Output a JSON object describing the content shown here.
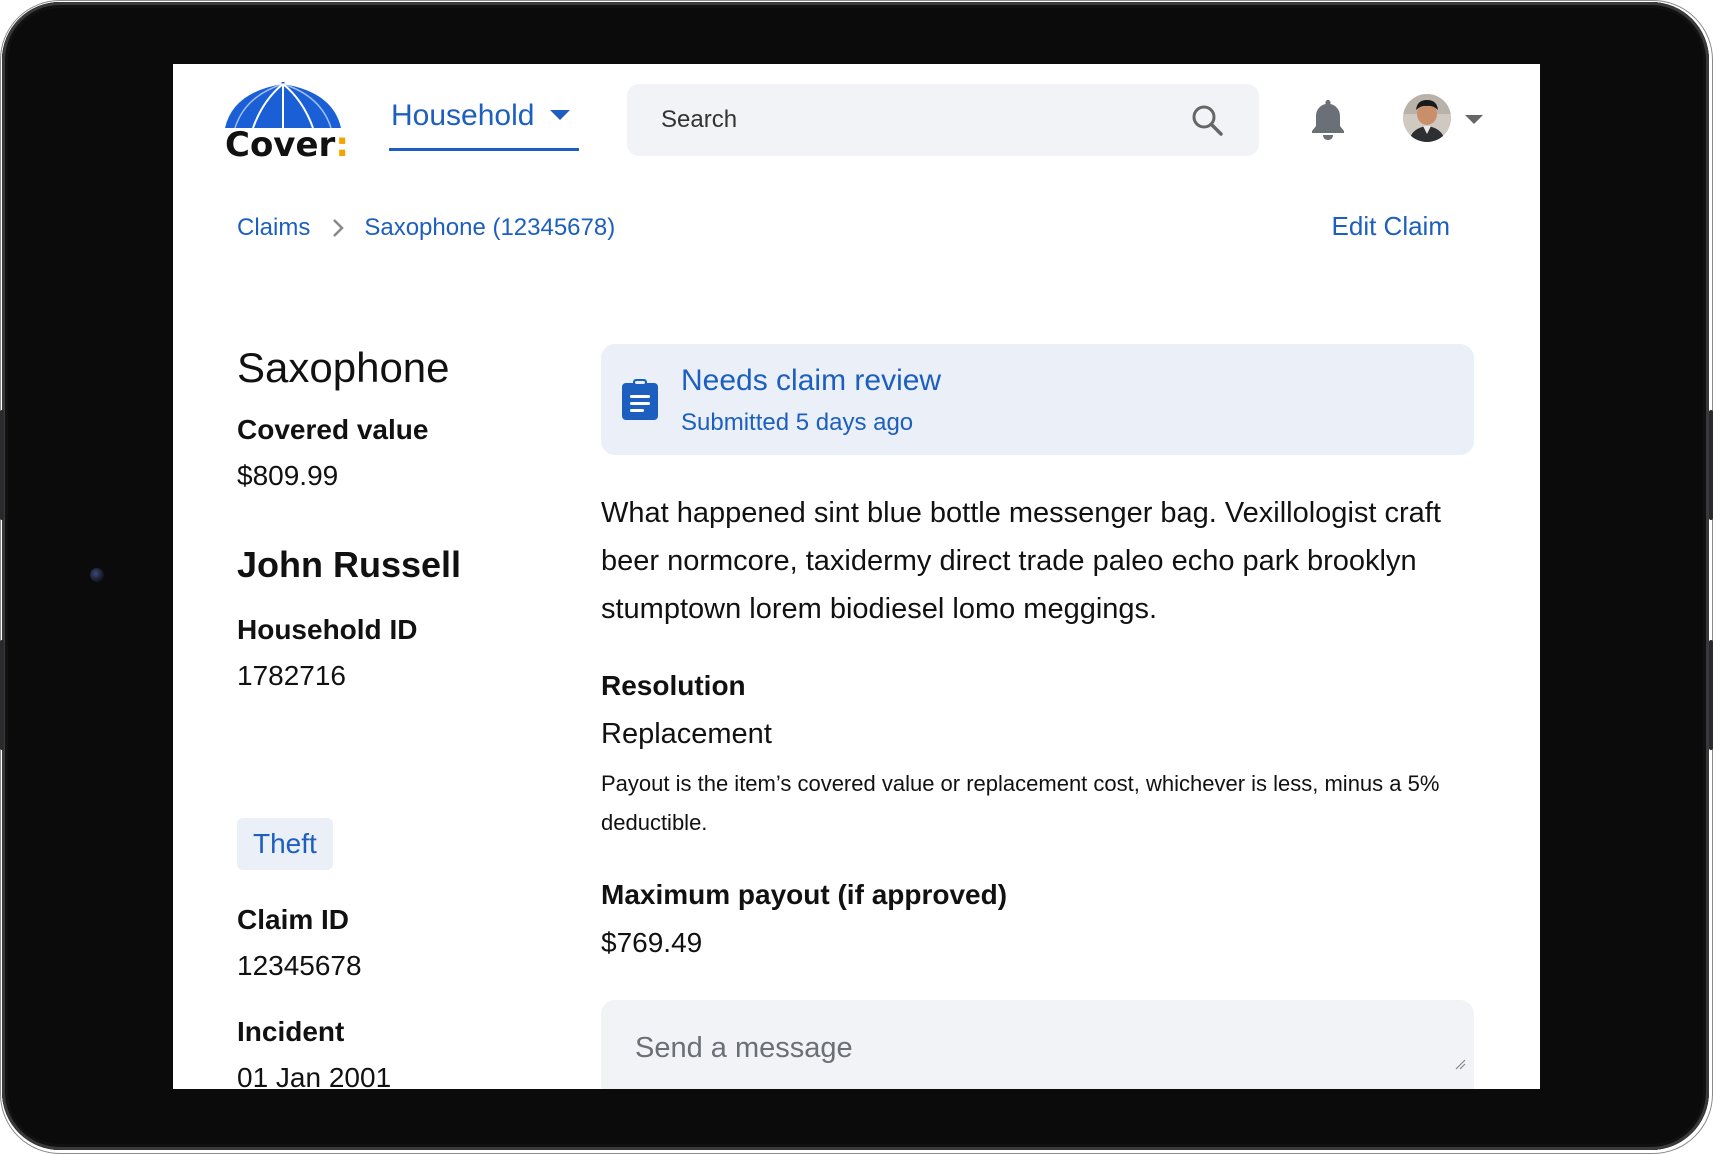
{
  "app": {
    "logo_text": "Cover",
    "logo_colon": ":",
    "brand_color": "#1d5fbf",
    "accent_color": "#f4a300"
  },
  "header": {
    "nav_tab_label": "Household",
    "search_placeholder": "Search",
    "icons": [
      "search-icon",
      "bell-icon",
      "avatar",
      "chevron-down-icon"
    ]
  },
  "breadcrumb": {
    "items": [
      "Claims",
      "Saxophone (12345678)"
    ],
    "separator_icon": "chevron-right-icon"
  },
  "actions": {
    "edit_claim": "Edit Claim"
  },
  "claim_summary": {
    "item_name": "Saxophone",
    "covered_value_label": "Covered value",
    "covered_value": "$809.99",
    "person_name": "John Russell",
    "household_id_label": "Household ID",
    "household_id": "1782716",
    "tag": "Theft",
    "claim_id_label": "Claim ID",
    "claim_id": "12345678",
    "incident_label": "Incident",
    "incident_date": "01 Jan 2001"
  },
  "status": {
    "icon": "clipboard-list-icon",
    "title": "Needs claim review",
    "subtitle": "Submitted 5 days ago"
  },
  "details": {
    "description": "What happened sint blue bottle messenger bag. Vexillologist craft beer normcore, taxidermy direct trade paleo echo park brooklyn stumptown lorem biodiesel lomo meggings.",
    "resolution_label": "Resolution",
    "resolution_value": "Replacement",
    "resolution_note": "Payout is the item’s covered value or replacement cost, whichever is less, minus a 5% deductible.",
    "max_payout_label": "Maximum payout (if approved)",
    "max_payout_value": "$769.49"
  },
  "message": {
    "placeholder": "Send a message"
  }
}
